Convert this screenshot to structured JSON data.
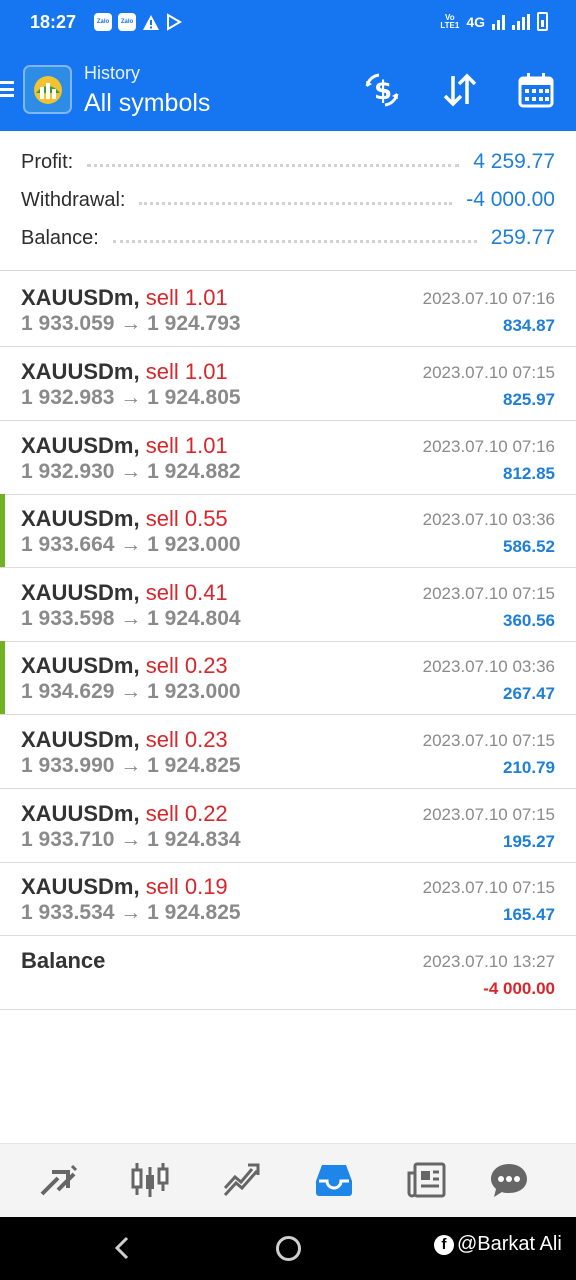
{
  "status_bar": {
    "time": "18:27",
    "network": "4G",
    "volte_label": "VoLTE"
  },
  "header": {
    "subtitle": "History",
    "title": "All symbols"
  },
  "summary": [
    {
      "label": "Profit:",
      "value": "4 259.77"
    },
    {
      "label": "Withdrawal:",
      "value": "-4 000.00"
    },
    {
      "label": "Balance:",
      "value": "259.77"
    }
  ],
  "deals": [
    {
      "symbol": "XAUUSDm",
      "type": "sell 1.01",
      "open": "1 933.059",
      "close": "1 924.793",
      "time": "2023.07.10 07:16",
      "profit": "834.87",
      "marked": false
    },
    {
      "symbol": "XAUUSDm",
      "type": "sell 1.01",
      "open": "1 932.983",
      "close": "1 924.805",
      "time": "2023.07.10 07:15",
      "profit": "825.97",
      "marked": false
    },
    {
      "symbol": "XAUUSDm",
      "type": "sell 1.01",
      "open": "1 932.930",
      "close": "1 924.882",
      "time": "2023.07.10 07:16",
      "profit": "812.85",
      "marked": false
    },
    {
      "symbol": "XAUUSDm",
      "type": "sell 0.55",
      "open": "1 933.664",
      "close": "1 923.000",
      "time": "2023.07.10 03:36",
      "profit": "586.52",
      "marked": true
    },
    {
      "symbol": "XAUUSDm",
      "type": "sell 0.41",
      "open": "1 933.598",
      "close": "1 924.804",
      "time": "2023.07.10 07:15",
      "profit": "360.56",
      "marked": false
    },
    {
      "symbol": "XAUUSDm",
      "type": "sell 0.23",
      "open": "1 934.629",
      "close": "1 923.000",
      "time": "2023.07.10 03:36",
      "profit": "267.47",
      "marked": true
    },
    {
      "symbol": "XAUUSDm",
      "type": "sell 0.23",
      "open": "1 933.990",
      "close": "1 924.825",
      "time": "2023.07.10 07:15",
      "profit": "210.79",
      "marked": false
    },
    {
      "symbol": "XAUUSDm",
      "type": "sell 0.22",
      "open": "1 933.710",
      "close": "1 924.834",
      "time": "2023.07.10 07:15",
      "profit": "195.27",
      "marked": false
    },
    {
      "symbol": "XAUUSDm",
      "type": "sell 0.19",
      "open": "1 933.534",
      "close": "1 924.825",
      "time": "2023.07.10 07:15",
      "profit": "165.47",
      "marked": false
    }
  ],
  "balance_op": {
    "label": "Balance",
    "time": "2023.07.10 13:27",
    "amount": "-4 000.00"
  },
  "arrow": "→",
  "comma": ",",
  "bottom_nav": [
    {
      "name": "quotes",
      "icon": "quotes-arrows-icon"
    },
    {
      "name": "chart",
      "icon": "candlestick-icon"
    },
    {
      "name": "trade",
      "icon": "trade-chart-icon"
    },
    {
      "name": "history",
      "icon": "inbox-tray-icon",
      "active": true
    },
    {
      "name": "news",
      "icon": "newspaper-icon"
    },
    {
      "name": "chat",
      "icon": "chat-bubble-icon"
    }
  ],
  "watermark": "@Barkat Ali",
  "colors": {
    "accent_blue": "#1675f0",
    "profit_blue": "#1e7fd8",
    "sell_red": "#d8262b",
    "marker_green": "#6fb324"
  }
}
